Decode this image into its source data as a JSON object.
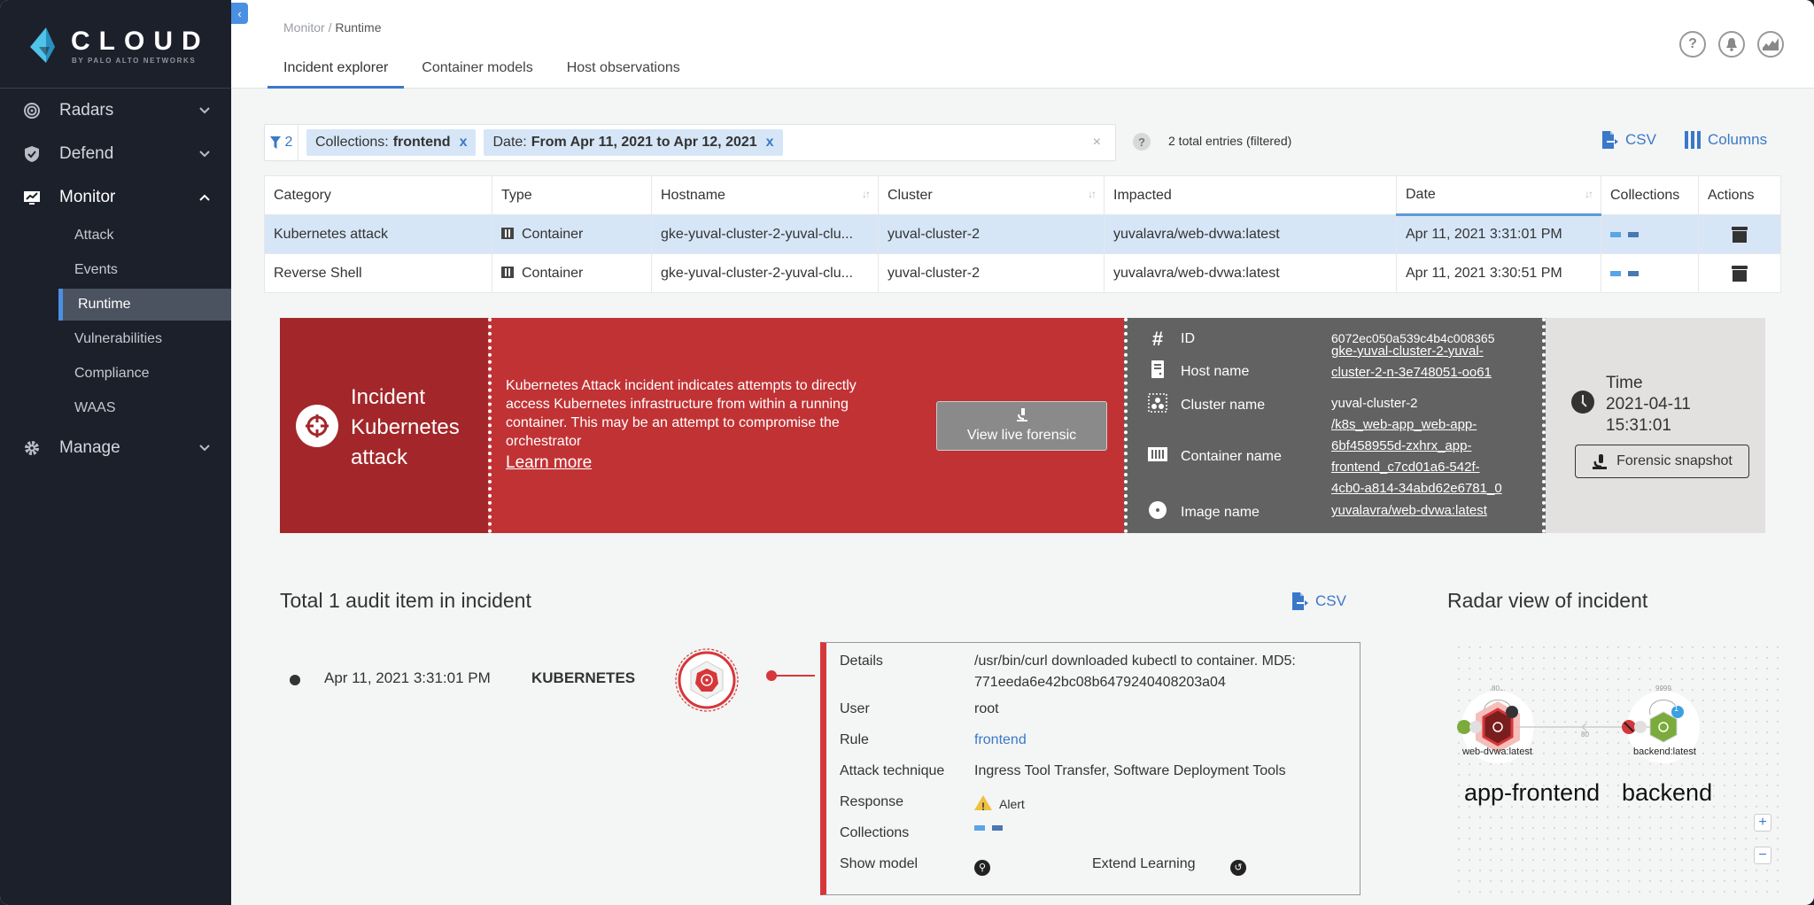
{
  "brand": {
    "name": "CLOUD",
    "sub": "BY PALO ALTO NETWORKS"
  },
  "sidebar": {
    "items": [
      {
        "label": "Radars",
        "icon": "radar-icon",
        "expanded": false
      },
      {
        "label": "Defend",
        "icon": "shield-check-icon",
        "expanded": false
      },
      {
        "label": "Monitor",
        "icon": "monitor-chart-icon",
        "expanded": true
      },
      {
        "label": "Manage",
        "icon": "gear-icon",
        "expanded": false
      }
    ],
    "monitor_sub": [
      "Attack",
      "Events",
      "Runtime",
      "Vulnerabilities",
      "Compliance",
      "WAAS"
    ],
    "active_sub": "Runtime"
  },
  "header": {
    "breadcrumb_parent": "Monitor",
    "breadcrumb_sep": " / ",
    "breadcrumb_current": "Runtime",
    "tabs": [
      "Incident explorer",
      "Container models",
      "Host observations"
    ],
    "active_tab": "Incident explorer",
    "icons": [
      "help-icon",
      "bell-icon",
      "chart-icon"
    ]
  },
  "filter": {
    "count": "2",
    "chips": [
      {
        "key": "Collections:",
        "value": "frontend",
        "remove": "x"
      },
      {
        "key": "Date:",
        "value": "From Apr 11, 2021 to Apr 12, 2021",
        "remove": "x"
      }
    ],
    "clear": "×",
    "entries": "2 total entries (filtered)",
    "csv_label": "CSV",
    "columns_label": "Columns"
  },
  "table": {
    "headers": [
      "Category",
      "Type",
      "Hostname",
      "Cluster",
      "Impacted",
      "Date",
      "Collections",
      "Actions"
    ],
    "rows": [
      {
        "category": "Kubernetes attack",
        "type": "Container",
        "hostname": "gke-yuval-cluster-2-yuval-clu...",
        "cluster": "yuval-cluster-2",
        "impacted": "yuvalavra/web-dvwa:latest",
        "date": "Apr 11, 2021 3:31:01 PM",
        "selected": true
      },
      {
        "category": "Reverse Shell",
        "type": "Container",
        "hostname": "gke-yuval-cluster-2-yuval-clu...",
        "cluster": "yuval-cluster-2",
        "impacted": "yuvalavra/web-dvwa:latest",
        "date": "Apr 11, 2021 3:30:51 PM",
        "selected": false
      }
    ],
    "collection_colors": [
      "#5aa5e6",
      "#4a78b0"
    ]
  },
  "incident": {
    "title_line1": "Incident",
    "title_line2": "Kubernetes",
    "title_line3": "attack",
    "description": "Kubernetes Attack incident indicates attempts to directly access Kubernetes infrastructure from within a running container. This may be an attempt to compromise the orchestrator",
    "learn_more": "Learn more",
    "view_live_forensic": "View live forensic",
    "info": {
      "id_label": "ID",
      "id_value": "6072ec050a539c4b4c008365",
      "host_label": "Host name",
      "host_value_1": "gke-yuval-cluster-2-yuval-",
      "host_value_2": "cluster-2-n-3e748051-oo61",
      "cluster_label": "Cluster name",
      "cluster_value": "yuval-cluster-2",
      "container_label": "Container name",
      "container_value": [
        "/k8s_web-app_web-app-",
        "6bf458955d-zxhrx_app-",
        "frontend_c7cd01a6-542f-",
        "4cb0-a814-34abd62e6781_0"
      ],
      "image_label": "Image name",
      "image_value": "yuvalavra/web-dvwa:latest"
    },
    "time_label": "Time",
    "time_date": "2021-04-11",
    "time_clock": "15:31:01",
    "forensic_snapshot": "Forensic snapshot",
    "colors": {
      "left": "#a3272a",
      "mid": "#c13234",
      "info": "#626262",
      "time": "#e2e1e0"
    }
  },
  "audit": {
    "title": "Total 1 audit item in incident",
    "csv_label": "CSV",
    "item": {
      "date": "Apr 11, 2021 3:31:01 PM",
      "kind": "KUBERNETES",
      "details_label": "Details",
      "details_value_1": "/usr/bin/curl downloaded kubectl to container. MD5:",
      "details_value_2": "771eeda6e42bc08b6479240408203a04",
      "user_label": "User",
      "user_value": "root",
      "rule_label": "Rule",
      "rule_value": "frontend",
      "technique_label": "Attack technique",
      "technique_value": "Ingress Tool Transfer, Software Deployment Tools",
      "response_label": "Response",
      "response_value": "Alert",
      "collections_label": "Collections",
      "show_model_label": "Show model",
      "extend_learning_label": "Extend Learning"
    }
  },
  "radar": {
    "title": "Radar view of incident",
    "nodes": [
      {
        "image": "web-dvwa:latest",
        "namespace": "app-frontend",
        "port_label": "80...",
        "badge": "1",
        "status": "attacked"
      },
      {
        "image": "backend:latest",
        "namespace": "backend",
        "port_label": "9999",
        "badge": "1",
        "status": "normal"
      }
    ],
    "edge_label": "80",
    "zoom_in": "+",
    "zoom_out": "−"
  }
}
